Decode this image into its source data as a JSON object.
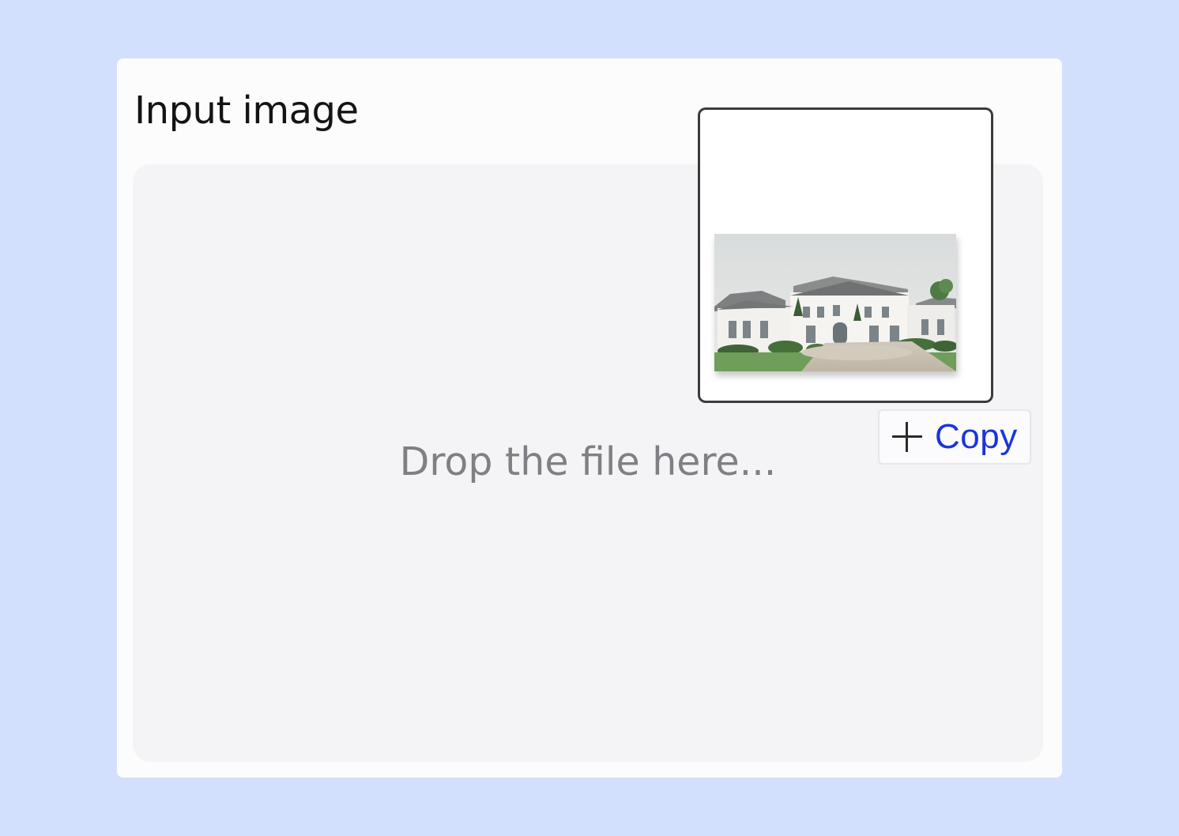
{
  "panel": {
    "title": "Input image"
  },
  "dropzone": {
    "hint": "Drop the file here..."
  },
  "drag_preview": {
    "icon": "house-thumbnail-image"
  },
  "copy_badge": {
    "icon": "plus-icon",
    "label": "Copy",
    "color": "#1a35d8"
  },
  "colors": {
    "page_background": "#d3e0fd",
    "panel_background": "#fcfcfc",
    "dropzone_background": "#f4f4f6"
  }
}
